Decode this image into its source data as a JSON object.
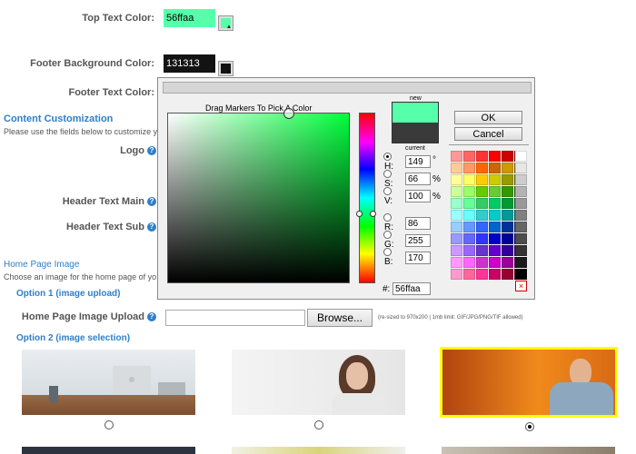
{
  "settings": {
    "top_text_color_label": "Top Text Color:",
    "top_text_color_value": "56ffaa",
    "top_text_color_hex": "#56ffaa",
    "footer_bg_label": "Footer Background Color:",
    "footer_bg_value": "131313",
    "footer_bg_hex": "#131313",
    "footer_text_label": "Footer Text Color:"
  },
  "content": {
    "section_title": "Content Customization",
    "description": "Please use the fields below to customize y",
    "logo_label": "Logo",
    "header_main_label": "Header Text Main",
    "header_sub_label": "Header Text Sub"
  },
  "home_image": {
    "section_title": "Home Page Image",
    "description": "Choose an image for the home page of yo",
    "option1_label": "Option 1 (image upload)",
    "upload_label": "Home Page Image Upload",
    "browse_label": "Browse...",
    "hint": "(re-sized to 970x200 | 1mb limit: GIF/JPG/PNG/TIF allowed)",
    "option2_label": "Option 2 (image selection)",
    "selected_index": 2
  },
  "picker": {
    "instruction": "Drag Markers To Pick A Color",
    "new_label": "new",
    "current_label": "current",
    "new_color": "#56ffaa",
    "current_color": "#3a3a3a",
    "ok_label": "OK",
    "cancel_label": "Cancel",
    "h_label": "H:",
    "h_value": "149",
    "h_unit": "°",
    "s_label": "S:",
    "s_value": "66",
    "s_unit": "%",
    "v_label": "V:",
    "v_value": "100",
    "v_unit": "%",
    "r_label": "R:",
    "r_value": "86",
    "g_label": "G:",
    "g_value": "255",
    "b_label": "B:",
    "b_value": "170",
    "hex_label": "#:",
    "hex_value": "56ffaa",
    "selected_mode": "H",
    "palette": [
      "#ff9999",
      "#ff6666",
      "#ff3333",
      "#ff0000",
      "#cc0000",
      "#990000",
      "#ffcc99",
      "#ff9966",
      "#ff6600",
      "#cc6600",
      "#cc9900",
      "#996600",
      "#ffff99",
      "#ffff66",
      "#ffcc00",
      "#cccc00",
      "#999900",
      "#666600",
      "#ccff99",
      "#99ff66",
      "#66cc00",
      "#66cc33",
      "#339900",
      "#336600",
      "#99ffcc",
      "#66ff99",
      "#33cc66",
      "#00cc66",
      "#009933",
      "#006633",
      "#99ffff",
      "#66ffff",
      "#33cccc",
      "#00cccc",
      "#009999",
      "#006666",
      "#99ccff",
      "#6699ff",
      "#3366ff",
      "#0066cc",
      "#003399",
      "#003366",
      "#9999ff",
      "#6666ff",
      "#3333ff",
      "#0000cc",
      "#000099",
      "#000066",
      "#cc99ff",
      "#9966ff",
      "#6633cc",
      "#6600cc",
      "#330099",
      "#330066",
      "#ff99ff",
      "#ff66ff",
      "#cc33cc",
      "#cc00cc",
      "#990099",
      "#660066",
      "#ff99cc",
      "#ff6699",
      "#ff3399",
      "#cc0066",
      "#990033",
      "#660033"
    ],
    "grays": [
      "#ffffff",
      "#e6e6e6",
      "#cccccc",
      "#b3b3b3",
      "#999999",
      "#808080",
      "#666666",
      "#4d4d4d",
      "#333333",
      "#1a1a1a",
      "#000000"
    ]
  }
}
